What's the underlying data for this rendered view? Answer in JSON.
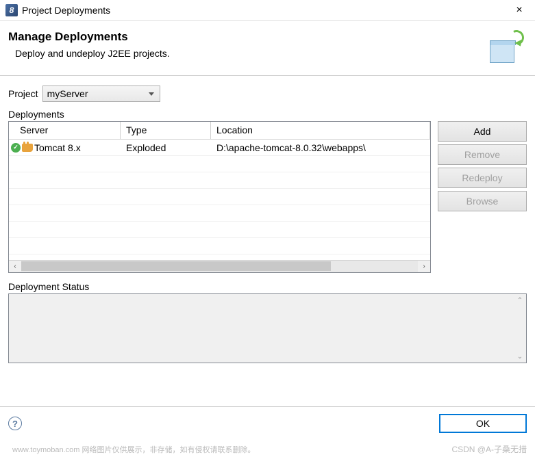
{
  "titlebar": {
    "icon_text": "8",
    "title": "Project Deployments",
    "close": "×"
  },
  "header": {
    "title": "Manage Deployments",
    "description": "Deploy and undeploy J2EE projects."
  },
  "project": {
    "label": "Project",
    "selected": "myServer"
  },
  "deployments": {
    "section_label": "Deployments",
    "columns": {
      "server": "Server",
      "type": "Type",
      "location": "Location"
    },
    "rows": [
      {
        "server": "Tomcat  8.x",
        "type": "Exploded",
        "location": "D:\\apache-tomcat-8.0.32\\webapps\\"
      }
    ]
  },
  "buttons": {
    "add": "Add",
    "remove": "Remove",
    "redeploy": "Redeploy",
    "browse": "Browse"
  },
  "status": {
    "label": "Deployment Status"
  },
  "footer": {
    "help": "?",
    "ok": "OK"
  },
  "watermarks": {
    "left": "www.toymoban.com 网络图片仅供展示，非存储，如有侵权请联系删除。",
    "right": "CSDN @A-子桑无措"
  }
}
